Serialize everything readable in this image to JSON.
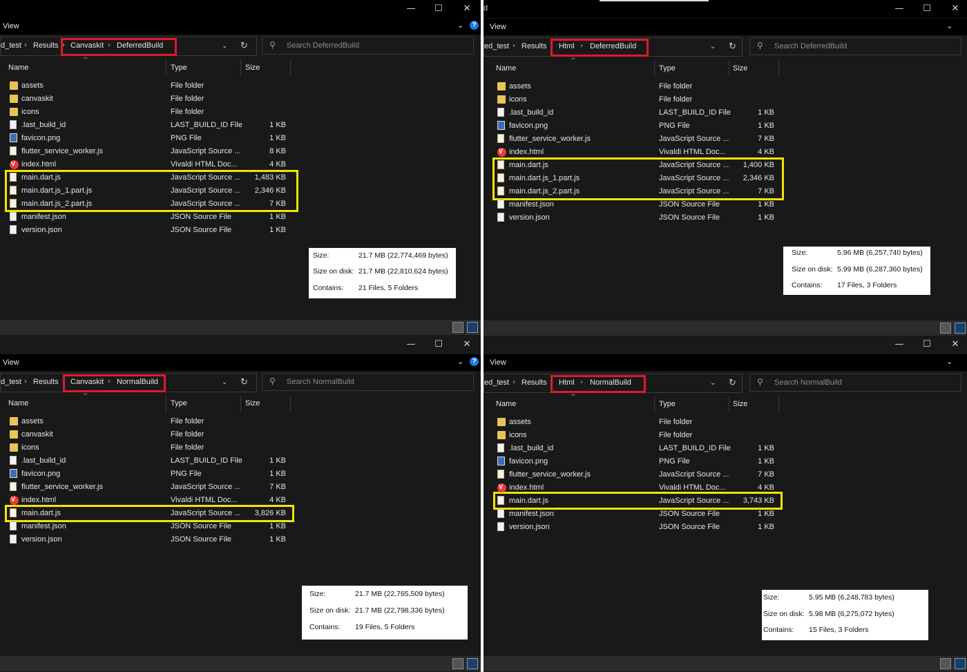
{
  "common": {
    "view_label": "View",
    "crumb_root": "d_test",
    "crumb_root_alt": "ed_test",
    "crumb_results": "Results",
    "col_name": "Name",
    "col_type": "Type",
    "col_size": "Size",
    "minimize": "—",
    "maximize": "☐",
    "close": "✕",
    "title_fragment": "d",
    "label_size": "Size:",
    "label_size_on_disk": "Size on disk:",
    "label_contains": "Contains:"
  },
  "panes": {
    "tl": {
      "crumb_a": "Canvaskit",
      "crumb_b": "DeferredBuild",
      "search_placeholder": "Search DeferredBuild",
      "files": [
        {
          "name": "assets",
          "type": "File folder",
          "size": "",
          "icon": "folder"
        },
        {
          "name": "canvaskit",
          "type": "File folder",
          "size": "",
          "icon": "folder"
        },
        {
          "name": "icons",
          "type": "File folder",
          "size": "",
          "icon": "folder"
        },
        {
          "name": ".last_build_id",
          "type": "LAST_BUILD_ID File",
          "size": "1 KB",
          "icon": "file"
        },
        {
          "name": "favicon.png",
          "type": "PNG File",
          "size": "1 KB",
          "icon": "png"
        },
        {
          "name": "flutter_service_worker.js",
          "type": "JavaScript Source ...",
          "size": "8 KB",
          "icon": "js"
        },
        {
          "name": "index.html",
          "type": "Vivaldi HTML Doc...",
          "size": "4 KB",
          "icon": "vivaldi"
        },
        {
          "name": "main.dart.js",
          "type": "JavaScript Source ...",
          "size": "1,483 KB",
          "icon": "js"
        },
        {
          "name": "main.dart.js_1.part.js",
          "type": "JavaScript Source ...",
          "size": "2,346 KB",
          "icon": "js"
        },
        {
          "name": "main.dart.js_2.part.js",
          "type": "JavaScript Source ...",
          "size": "7 KB",
          "icon": "js"
        },
        {
          "name": "manifest.json",
          "type": "JSON Source File",
          "size": "1 KB",
          "icon": "file"
        },
        {
          "name": "version.json",
          "type": "JSON Source File",
          "size": "1 KB",
          "icon": "file"
        }
      ],
      "props": {
        "size": "21.7 MB (22,774,469 bytes)",
        "size_on_disk": "21.7 MB (22,810,624 bytes)",
        "contains": "21 Files, 5 Folders"
      }
    },
    "tr": {
      "crumb_a": "Html",
      "crumb_b": "DeferredBuild",
      "search_placeholder": "Search DeferredBuild",
      "files": [
        {
          "name": "assets",
          "type": "File folder",
          "size": "",
          "icon": "folder"
        },
        {
          "name": "icons",
          "type": "File folder",
          "size": "",
          "icon": "folder"
        },
        {
          "name": ".last_build_id",
          "type": "LAST_BUILD_ID File",
          "size": "1 KB",
          "icon": "file"
        },
        {
          "name": "favicon.png",
          "type": "PNG File",
          "size": "1 KB",
          "icon": "png"
        },
        {
          "name": "flutter_service_worker.js",
          "type": "JavaScript Source ...",
          "size": "7 KB",
          "icon": "js"
        },
        {
          "name": "index.html",
          "type": "Vivaldi HTML Doc...",
          "size": "4 KB",
          "icon": "vivaldi"
        },
        {
          "name": "main.dart.js",
          "type": "JavaScript Source ...",
          "size": "1,400 KB",
          "icon": "js"
        },
        {
          "name": "main.dart.js_1.part.js",
          "type": "JavaScript Source ...",
          "size": "2,346 KB",
          "icon": "js"
        },
        {
          "name": "main.dart.js_2.part.js",
          "type": "JavaScript Source ...",
          "size": "7 KB",
          "icon": "js"
        },
        {
          "name": "manifest.json",
          "type": "JSON Source File",
          "size": "1 KB",
          "icon": "file"
        },
        {
          "name": "version.json",
          "type": "JSON Source File",
          "size": "1 KB",
          "icon": "file"
        }
      ],
      "props": {
        "size": "5.96 MB (6,257,740 bytes)",
        "size_on_disk": "5.99 MB (6,287,360 bytes)",
        "contains": "17 Files, 3 Folders"
      }
    },
    "bl": {
      "crumb_a": "Canvaskit",
      "crumb_b": "NormalBuild",
      "search_placeholder": "Search NormalBuild",
      "files": [
        {
          "name": "assets",
          "type": "File folder",
          "size": "",
          "icon": "folder"
        },
        {
          "name": "canvaskit",
          "type": "File folder",
          "size": "",
          "icon": "folder"
        },
        {
          "name": "icons",
          "type": "File folder",
          "size": "",
          "icon": "folder"
        },
        {
          "name": ".last_build_id",
          "type": "LAST_BUILD_ID File",
          "size": "1 KB",
          "icon": "file"
        },
        {
          "name": "favicon.png",
          "type": "PNG File",
          "size": "1 KB",
          "icon": "png"
        },
        {
          "name": "flutter_service_worker.js",
          "type": "JavaScript Source ...",
          "size": "7 KB",
          "icon": "js"
        },
        {
          "name": "index.html",
          "type": "Vivaldi HTML Doc...",
          "size": "4 KB",
          "icon": "vivaldi"
        },
        {
          "name": "main.dart.js",
          "type": "JavaScript Source ...",
          "size": "3,826 KB",
          "icon": "js"
        },
        {
          "name": "manifest.json",
          "type": "JSON Source File",
          "size": "1 KB",
          "icon": "file"
        },
        {
          "name": "version.json",
          "type": "JSON Source File",
          "size": "1 KB",
          "icon": "file"
        }
      ],
      "props": {
        "size": "21.7 MB (22,765,509 bytes)",
        "size_on_disk": "21.7 MB (22,798,336 bytes)",
        "contains": "19 Files, 5 Folders"
      }
    },
    "br": {
      "crumb_a": "Html",
      "crumb_b": "NormalBuild",
      "search_placeholder": "Search NormalBuild",
      "files": [
        {
          "name": "assets",
          "type": "File folder",
          "size": "",
          "icon": "folder"
        },
        {
          "name": "icons",
          "type": "File folder",
          "size": "",
          "icon": "folder"
        },
        {
          "name": ".last_build_id",
          "type": "LAST_BUILD_ID File",
          "size": "1 KB",
          "icon": "file"
        },
        {
          "name": "favicon.png",
          "type": "PNG File",
          "size": "1 KB",
          "icon": "png"
        },
        {
          "name": "flutter_service_worker.js",
          "type": "JavaScript Source ...",
          "size": "7 KB",
          "icon": "js"
        },
        {
          "name": "index.html",
          "type": "Vivaldi HTML Doc...",
          "size": "4 KB",
          "icon": "vivaldi"
        },
        {
          "name": "main.dart.js",
          "type": "JavaScript Source ...",
          "size": "3,743 KB",
          "icon": "js"
        },
        {
          "name": "manifest.json",
          "type": "JSON Source File",
          "size": "1 KB",
          "icon": "file"
        },
        {
          "name": "version.json",
          "type": "JSON Source File",
          "size": "1 KB",
          "icon": "file"
        }
      ],
      "props": {
        "size": "5.95 MB (6,248,783 bytes)",
        "size_on_disk": "5.98 MB (6,275,072 bytes)",
        "contains": "15 Files, 3 Folders"
      }
    }
  },
  "colors": {
    "highlight_box": "#f5e400",
    "crumb_box": "#e0192b",
    "background": "#191919",
    "folder": "#e9c35a"
  }
}
